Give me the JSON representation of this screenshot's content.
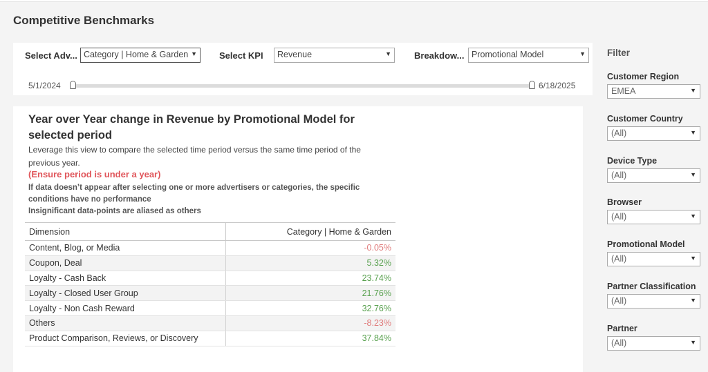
{
  "page": {
    "title": "Competitive Benchmarks"
  },
  "controls": {
    "advertiser": {
      "label": "Select  Adv...",
      "value": "Category | Home & Garden"
    },
    "kpi": {
      "label": "Select KPI",
      "value": "Revenue"
    },
    "breakdown": {
      "label": "Breakdow...",
      "value": "Promotional Model"
    },
    "date_range": {
      "start": "5/1/2024",
      "end": "6/18/2025"
    }
  },
  "card": {
    "title": "Year over Year change in Revenue by Promotional Model for selected period",
    "description": "Leverage this view to compare the selected time period versus the same time period of the previous year.",
    "warning": "(Ensure period is under a year)",
    "note": "If data doesn’t appear after selecting one or more advertisers or categories, the specific conditions have no performance\nInsignificant data-points are aliased as others"
  },
  "table": {
    "headers": {
      "dimension": "Dimension",
      "value": "Category | Home & Garden"
    },
    "rows": [
      {
        "dimension": "Content, Blog, or Media",
        "value": "-0.05%"
      },
      {
        "dimension": "Coupon, Deal",
        "value": "5.32%"
      },
      {
        "dimension": "Loyalty - Cash Back",
        "value": "23.74%"
      },
      {
        "dimension": "Loyalty - Closed User Group",
        "value": "21.76%"
      },
      {
        "dimension": "Loyalty - Non Cash Reward",
        "value": "32.76%"
      },
      {
        "dimension": "Others",
        "value": "-8.23%"
      },
      {
        "dimension": "Product Comparison, Reviews, or Discovery",
        "value": "37.84%"
      }
    ]
  },
  "filters": {
    "title": "Filter",
    "items": [
      {
        "label": "Customer Region",
        "value": "EMEA"
      },
      {
        "label": "Customer Country",
        "value": "(All)"
      },
      {
        "label": "Device Type",
        "value": "(All)"
      },
      {
        "label": "Browser",
        "value": "(All)"
      },
      {
        "label": "Promotional Model",
        "value": "(All)"
      },
      {
        "label": "Partner Classification",
        "value": "(All)"
      },
      {
        "label": "Partner",
        "value": "(All)"
      }
    ]
  },
  "colors": {
    "negative": "#e07b7b",
    "positive": "#59a14f",
    "warning": "#e0565b"
  },
  "icons": {
    "dropdown": "caret-down-icon"
  }
}
